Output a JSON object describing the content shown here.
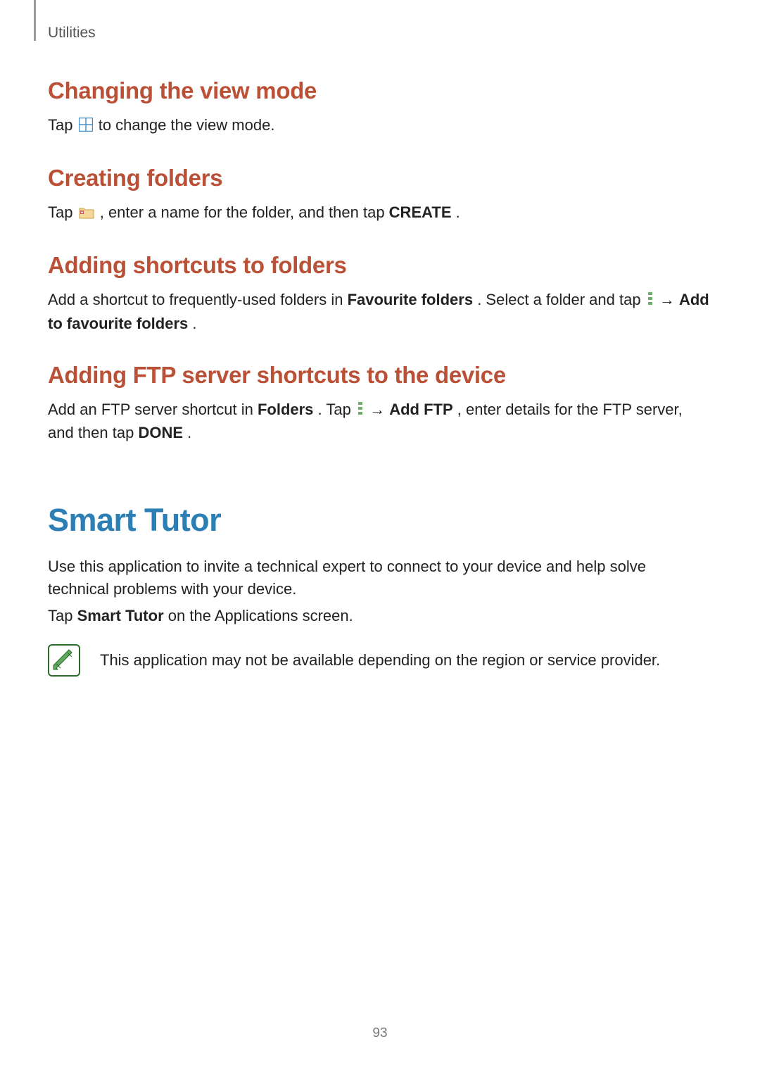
{
  "header": {
    "section": "Utilities"
  },
  "sections": {
    "s1": {
      "title": "Changing the view mode",
      "p_before": "Tap ",
      "p_after": " to change the view mode."
    },
    "s2": {
      "title": "Creating folders",
      "p_before": "Tap ",
      "p_mid": ", enter a name for the folder, and then tap ",
      "bold": "CREATE",
      "p_after": "."
    },
    "s3": {
      "title": "Adding shortcuts to folders",
      "p_before": "Add a shortcut to frequently-used folders in ",
      "bold1": "Favourite folders",
      "p_mid1": ". Select a folder and tap ",
      "arrow": " → ",
      "bold2": "Add to favourite folders",
      "p_after": "."
    },
    "s4": {
      "title": "Adding FTP server shortcuts to the device",
      "p_before": "Add an FTP server shortcut in ",
      "bold1": "Folders",
      "p_mid1": ". Tap ",
      "arrow": " → ",
      "bold2": "Add FTP",
      "p_mid2": ", enter details for the FTP server, and then tap ",
      "bold3": "DONE",
      "p_after": "."
    }
  },
  "main": {
    "title": "Smart Tutor",
    "p1": "Use this application to invite a technical expert to connect to your device and help solve technical problems with your device.",
    "p2_before": "Tap ",
    "p2_bold": "Smart Tutor",
    "p2_after": " on the Applications screen.",
    "note": "This application may not be available depending on the region or service provider."
  },
  "footer": {
    "page": "93"
  }
}
